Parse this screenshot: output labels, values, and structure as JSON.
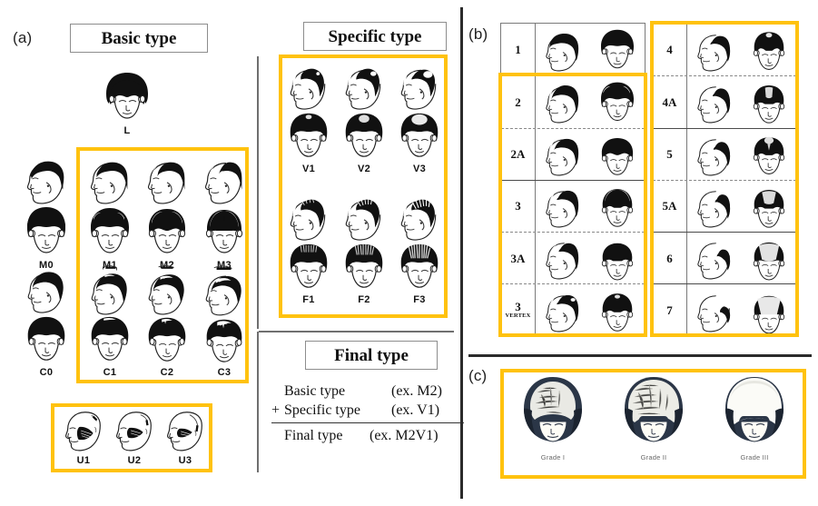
{
  "figure": {
    "panels": [
      {
        "id": "a",
        "letter": "(a)"
      },
      {
        "id": "b",
        "letter": "(b)"
      },
      {
        "id": "c",
        "letter": "(c)"
      }
    ]
  },
  "panel_a": {
    "letter": "(a)",
    "basic_type_title": "Basic type",
    "rows": [
      {
        "name": "L",
        "items": [
          {
            "label": "L",
            "view": "front",
            "pattern": "full"
          }
        ]
      },
      {
        "name": "M",
        "items": [
          {
            "label": "M0",
            "view": "pair",
            "pattern": "m0"
          },
          {
            "label": "M1",
            "view": "pair",
            "pattern": "m1"
          },
          {
            "label": "M2",
            "view": "pair",
            "pattern": "m2"
          },
          {
            "label": "M3",
            "view": "pair",
            "pattern": "m3"
          }
        ]
      },
      {
        "name": "C",
        "items": [
          {
            "label": "C0",
            "view": "pair",
            "pattern": "c0"
          },
          {
            "label": "C1",
            "view": "pair",
            "pattern": "c1"
          },
          {
            "label": "C2",
            "view": "pair",
            "pattern": "c2"
          },
          {
            "label": "C3",
            "view": "pair",
            "pattern": "c3"
          }
        ]
      },
      {
        "name": "U",
        "items": [
          {
            "label": "U1",
            "view": "side",
            "pattern": "u1"
          },
          {
            "label": "U2",
            "view": "side",
            "pattern": "u2"
          },
          {
            "label": "U3",
            "view": "side",
            "pattern": "u3"
          }
        ]
      }
    ],
    "highlight_boxes": [
      {
        "name": "basic-type-M-C-highlight"
      },
      {
        "name": "basic-type-U-highlight"
      }
    ]
  },
  "panel_a_middle": {
    "specific_type_title": "Specific type",
    "final_type_title": "Final type",
    "specific_rows": [
      {
        "name": "V",
        "items": [
          {
            "label": "V1"
          },
          {
            "label": "V2"
          },
          {
            "label": "V3"
          }
        ]
      },
      {
        "name": "F",
        "items": [
          {
            "label": "F1"
          },
          {
            "label": "F2"
          },
          {
            "label": "F3"
          }
        ]
      }
    ],
    "final_formula": {
      "line1_term": "Basic type",
      "line1_ex": "(ex. M2)",
      "line2_op": "+",
      "line2_term": "Specific type",
      "line2_ex": "(ex. V1)",
      "line3_term": "Final type",
      "line3_ex": "(ex. M2V1)"
    }
  },
  "panel_b": {
    "letter": "(b)",
    "left_column": [
      {
        "label": "1",
        "sub": "",
        "separator_below": "solid",
        "highlighted": false
      },
      {
        "label": "2",
        "sub": "",
        "separator_below": "dashed",
        "highlighted": true
      },
      {
        "label": "2A",
        "sub": "",
        "separator_below": "solid",
        "highlighted": true
      },
      {
        "label": "3",
        "sub": "",
        "separator_below": "dashed",
        "highlighted": true
      },
      {
        "label": "3A",
        "sub": "",
        "separator_below": "dashed",
        "highlighted": true
      },
      {
        "label": "3",
        "sub": "VERTEX",
        "separator_below": "none",
        "highlighted": true
      }
    ],
    "right_column": [
      {
        "label": "4",
        "sub": "",
        "separator_below": "dashed",
        "highlighted": true
      },
      {
        "label": "4A",
        "sub": "",
        "separator_below": "solid",
        "highlighted": true
      },
      {
        "label": "5",
        "sub": "",
        "separator_below": "dashed",
        "highlighted": true
      },
      {
        "label": "5A",
        "sub": "",
        "separator_below": "solid",
        "highlighted": true
      },
      {
        "label": "6",
        "sub": "",
        "separator_below": "solid",
        "highlighted": true
      },
      {
        "label": "7",
        "sub": "",
        "separator_below": "none",
        "highlighted": true
      }
    ]
  },
  "panel_c": {
    "letter": "(c)",
    "grades": [
      {
        "label": "Grade I",
        "pattern": "ludwig1"
      },
      {
        "label": "Grade II",
        "pattern": "ludwig2"
      },
      {
        "label": "Grade III",
        "pattern": "ludwig3"
      }
    ]
  },
  "colors": {
    "highlight": "#FFC20E",
    "divider": "#6f6f6f",
    "divider_dark": "#2b2b2b",
    "ink": "#111111",
    "page_background": "#ffffff"
  }
}
